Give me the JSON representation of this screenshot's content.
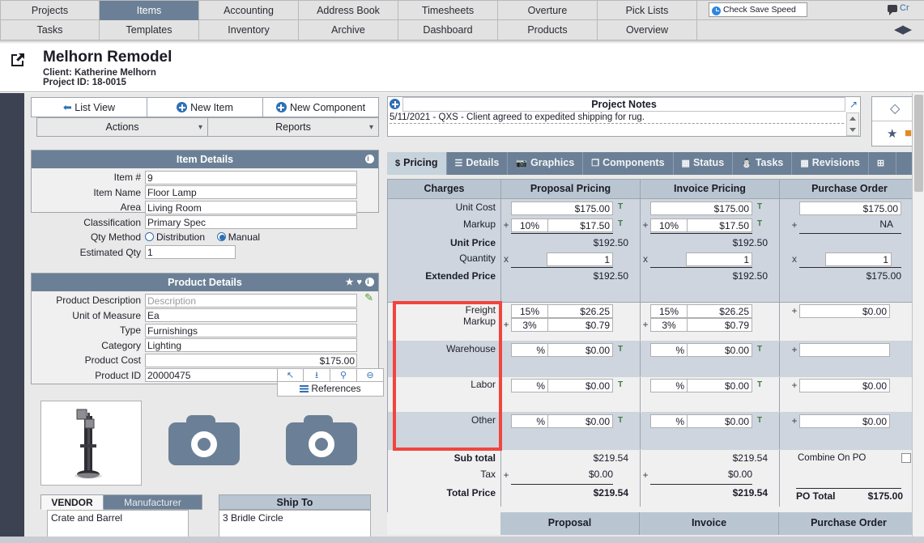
{
  "topnav": {
    "row1": [
      "Projects",
      "Items",
      "Accounting",
      "Address Book",
      "Timesheets",
      "Overture",
      "Pick Lists"
    ],
    "row2": [
      "Tasks",
      "Templates",
      "Inventory",
      "Archive",
      "Dashboard",
      "Products",
      "Overview"
    ],
    "active": "Items",
    "save_speed_label": "Check Save Speed",
    "comment_label": "Cr"
  },
  "project": {
    "title": "Melhorn Remodel",
    "client": "Client: Katherine Melhorn",
    "project_id": "Project ID: 18-0015"
  },
  "toolbar": {
    "list_view": "List View",
    "new_item": "New Item",
    "new_component": "New Component",
    "actions": "Actions",
    "reports": "Reports"
  },
  "item_details": {
    "title": "Item Details",
    "fields": [
      {
        "label": "Item #",
        "value": "9"
      },
      {
        "label": "Item Name",
        "value": "Floor Lamp"
      },
      {
        "label": "Area",
        "value": "Living Room"
      },
      {
        "label": "Classification",
        "value": "Primary Spec"
      }
    ],
    "qty_method_label": "Qty Method",
    "qty_method_options": [
      "Distribution",
      "Manual"
    ],
    "qty_method_selected": "Manual",
    "estimated_qty_label": "Estimated Qty",
    "estimated_qty_value": "1"
  },
  "product_details": {
    "title": "Product Details",
    "description_label": "Product Description",
    "description_placeholder": "Description",
    "fields": [
      {
        "label": "Unit of Measure",
        "value": "Ea"
      },
      {
        "label": "Type",
        "value": "Furnishings"
      },
      {
        "label": "Category",
        "value": "Lighting"
      }
    ],
    "product_cost_label": "Product Cost",
    "product_cost_value": "$175.00",
    "product_id_label": "Product ID",
    "product_id_value": "20000475",
    "references_label": "References"
  },
  "vendor": {
    "tab_vendor": "VENDOR",
    "tab_manufacturer": "Manufacturer",
    "value": "Crate and Barrel",
    "ship_to_label": "Ship To",
    "ship_to_value": "3 Bridle Circle"
  },
  "notes": {
    "title": "Project Notes",
    "entry": "5/11/2021 - QXS - Client agreed to expedited shipping for rug."
  },
  "tabs": [
    {
      "label": "Pricing",
      "icon": "$",
      "active": true
    },
    {
      "label": "Details",
      "icon": "list",
      "active": false
    },
    {
      "label": "Graphics",
      "icon": "camera",
      "active": false
    },
    {
      "label": "Components",
      "icon": "copy",
      "active": false
    },
    {
      "label": "Status",
      "icon": "calendar",
      "active": false
    },
    {
      "label": "Tasks",
      "icon": "people",
      "active": false
    },
    {
      "label": "Revisions",
      "icon": "book",
      "active": false
    }
  ],
  "pricing": {
    "columns": [
      "Charges",
      "Proposal Pricing",
      "Invoice Pricing",
      "Purchase Order"
    ],
    "rows": [
      {
        "label": "Unit Cost",
        "proposal": {
          "amount": "$175.00",
          "tax": "T"
        },
        "invoice": {
          "amount": "$175.00",
          "tax": "T"
        },
        "po": {
          "amount": "$175.00"
        }
      },
      {
        "label": "Markup",
        "proposal": {
          "op": "+",
          "pct": "10%",
          "amount": "$17.50",
          "tax": "T"
        },
        "invoice": {
          "op": "+",
          "pct": "10%",
          "amount": "$17.50",
          "tax": "T"
        },
        "po": {
          "op": "+",
          "amount": "NA"
        }
      },
      {
        "label": "Unit Price",
        "proposal": {
          "amount": "$192.50"
        },
        "invoice": {
          "amount": "$192.50"
        },
        "po": {
          "amount": ""
        }
      },
      {
        "label": "Quantity",
        "proposal": {
          "op": "x",
          "amount": "1"
        },
        "invoice": {
          "op": "x",
          "amount": "1"
        },
        "po": {
          "op": "x",
          "amount": "1"
        }
      },
      {
        "label": "Extended Price",
        "proposal": {
          "amount": "$192.50"
        },
        "invoice": {
          "amount": "$192.50"
        },
        "po": {
          "amount": "$175.00"
        }
      }
    ],
    "freight": {
      "label": "Freight",
      "markup_label": "Markup",
      "proposal": {
        "pct": "15%",
        "amount": "$26.25",
        "mk_op": "+",
        "mk_pct": "3%",
        "mk_amount": "$0.79"
      },
      "invoice": {
        "pct": "15%",
        "amount": "$26.25",
        "mk_op": "+",
        "mk_pct": "3%",
        "mk_amount": "$0.79"
      },
      "po": {
        "op": "+",
        "amount": "$0.00"
      }
    },
    "warehouse": {
      "label": "Warehouse",
      "proposal": {
        "pct": "%",
        "amount": "$0.00",
        "tax": "T"
      },
      "invoice": {
        "pct": "%",
        "amount": "$0.00",
        "tax": "T"
      },
      "po": {
        "op": "+",
        "amount": ""
      }
    },
    "labor": {
      "label": "Labor",
      "proposal": {
        "pct": "%",
        "amount": "$0.00",
        "tax": "T"
      },
      "invoice": {
        "pct": "%",
        "amount": "$0.00",
        "tax": "T"
      },
      "po": {
        "op": "+",
        "amount": "$0.00"
      }
    },
    "other": {
      "label": "Other",
      "proposal": {
        "pct": "%",
        "amount": "$0.00",
        "tax": "T"
      },
      "invoice": {
        "pct": "%",
        "amount": "$0.00",
        "tax": "T"
      },
      "po": {
        "op": "+",
        "amount": "$0.00"
      }
    },
    "totals": {
      "subtotal_label": "Sub total",
      "tax_label": "Tax",
      "total_label": "Total Price",
      "proposal": {
        "subtotal": "$219.54",
        "tax_op": "+",
        "tax": "$0.00",
        "total": "$219.54"
      },
      "invoice": {
        "subtotal": "$219.54",
        "tax_op": "+",
        "tax": "$0.00",
        "total": "$219.54"
      },
      "po": {
        "combine_label": "Combine On PO",
        "po_total_label": "PO Total",
        "po_total": "$175.00"
      }
    },
    "footer": [
      "Proposal",
      "Invoice",
      "Purchase Order"
    ]
  },
  "colors": {
    "brand": "#6b8096",
    "header_band": "#b9c6d2",
    "highlight": "#f1453d",
    "link": "#2f6fb5",
    "tax_green": "#3f7a3f"
  }
}
